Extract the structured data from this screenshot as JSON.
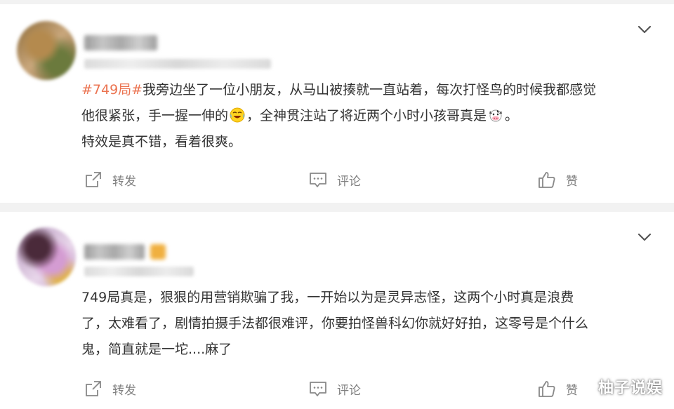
{
  "comments": [
    {
      "hashtag": "#749局#",
      "lines": [
        "我旁边坐了一位小朋友，从马山被揍就一直站着，每次打怪鸟的时候我都感觉",
        "他很紧张，手一握一伸的",
        "，全神贯注站了将近两个小时小孩哥真是",
        "。",
        "特效是真不错，看着很爽。"
      ],
      "emojis": [
        "laughing-crying-emoji",
        "cow-emoji"
      ]
    },
    {
      "lines": [
        "749局真是，狠狠的用营销欺骗了我，一开始以为是灵异志怪，这两个小时真是浪费",
        "了，太难看了，剧情拍摄手法都很难评，你要拍怪兽科幻你就好好拍，这零号是个什么",
        "鬼，简直就是一坨....麻了"
      ]
    }
  ],
  "actions": {
    "forward": "转发",
    "comment": "评论",
    "like": "赞"
  },
  "watermark": "柚子说娱",
  "colors": {
    "hashtag": "#eb7350",
    "text": "#333333",
    "action_text": "#808080",
    "background": "#f2f2f2"
  }
}
